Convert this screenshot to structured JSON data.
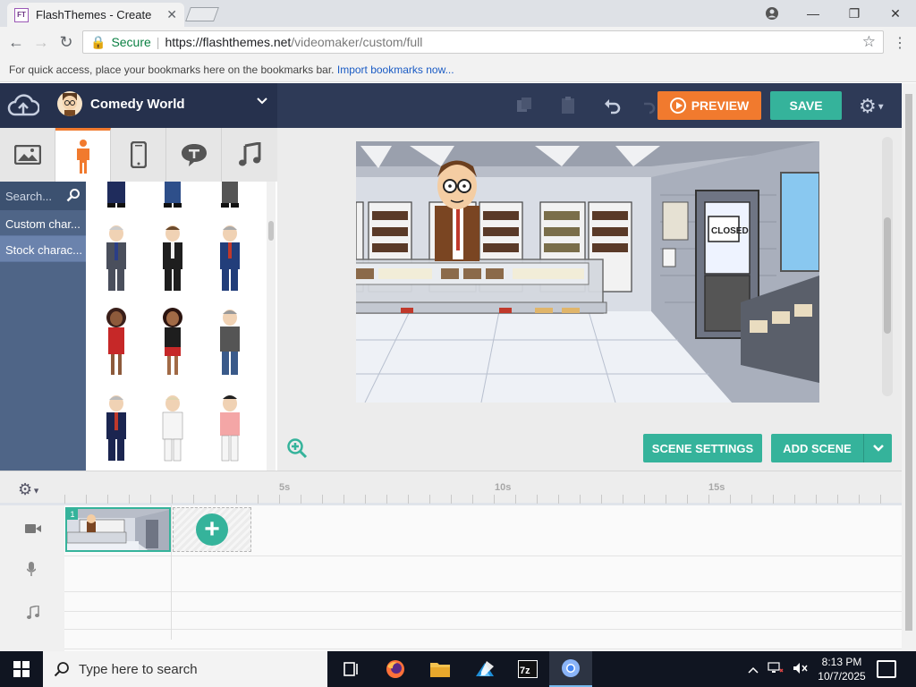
{
  "browser": {
    "tab_title": "FlashThemes - Create",
    "favicon_text": "FT",
    "url_secure_label": "Secure",
    "url_host": "https://flashthemes.net",
    "url_path": "/videomaker/custom/full",
    "bookmarks_text": "For quick access, place your bookmarks here on the bookmarks bar.",
    "bookmarks_link": "Import bookmarks now..."
  },
  "app": {
    "theme_name": "Comedy World",
    "preview_label": "PREVIEW",
    "save_label": "SAVE",
    "search_placeholder": "Search...",
    "side_items": [
      "Custom char...",
      "Stock charac..."
    ],
    "scene_settings_label": "SCENE SETTINGS",
    "add_scene_label": "ADD SCENE",
    "scene_sign": "CLOSED",
    "timeline": {
      "ticks": [
        "5s",
        "10s",
        "15s"
      ],
      "scene_number": "1"
    }
  },
  "taskbar": {
    "search_placeholder": "Type here to search",
    "time": "8:13 PM",
    "date": "10/7/2025"
  },
  "colors": {
    "accent_teal": "#35b39b",
    "accent_orange": "#f17a2e",
    "topbar_navy": "#2e3a57",
    "library_blue": "#4f6587"
  }
}
